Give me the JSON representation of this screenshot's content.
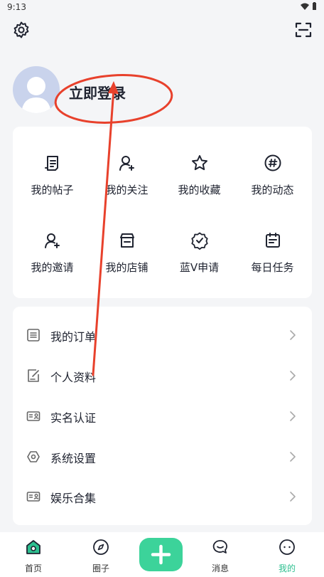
{
  "status_bar": {
    "time": "9:13"
  },
  "profile": {
    "login_label": "立即登录"
  },
  "grid": {
    "items": [
      {
        "label": "我的帖子",
        "icon": "post-icon"
      },
      {
        "label": "我的关注",
        "icon": "follow-icon"
      },
      {
        "label": "我的收藏",
        "icon": "star-icon"
      },
      {
        "label": "我的动态",
        "icon": "hashtag-icon"
      },
      {
        "label": "我的邀请",
        "icon": "invite-icon"
      },
      {
        "label": "我的店铺",
        "icon": "store-icon"
      },
      {
        "label": "蓝V申请",
        "icon": "verified-badge-icon"
      },
      {
        "label": "每日任务",
        "icon": "calendar-icon"
      }
    ]
  },
  "menu": {
    "items": [
      {
        "label": "我的订单",
        "icon": "order-list-icon"
      },
      {
        "label": "个人资料",
        "icon": "edit-profile-icon"
      },
      {
        "label": "实名认证",
        "icon": "id-card-icon"
      },
      {
        "label": "系统设置",
        "icon": "hexagon-settings-icon"
      },
      {
        "label": "娱乐合集",
        "icon": "id-card-icon"
      }
    ]
  },
  "tab_bar": {
    "items": [
      {
        "label": "首页",
        "icon": "home-icon"
      },
      {
        "label": "圈子",
        "icon": "compass-icon"
      },
      {
        "label": "消息",
        "icon": "message-icon"
      },
      {
        "label": "我的",
        "icon": "profile-face-icon"
      }
    ],
    "active_index": 3
  },
  "colors": {
    "accent": "#3cd39a",
    "active_tab": "#2dbf8f",
    "annotation": "#e8412c",
    "background": "#f4f5f7"
  }
}
